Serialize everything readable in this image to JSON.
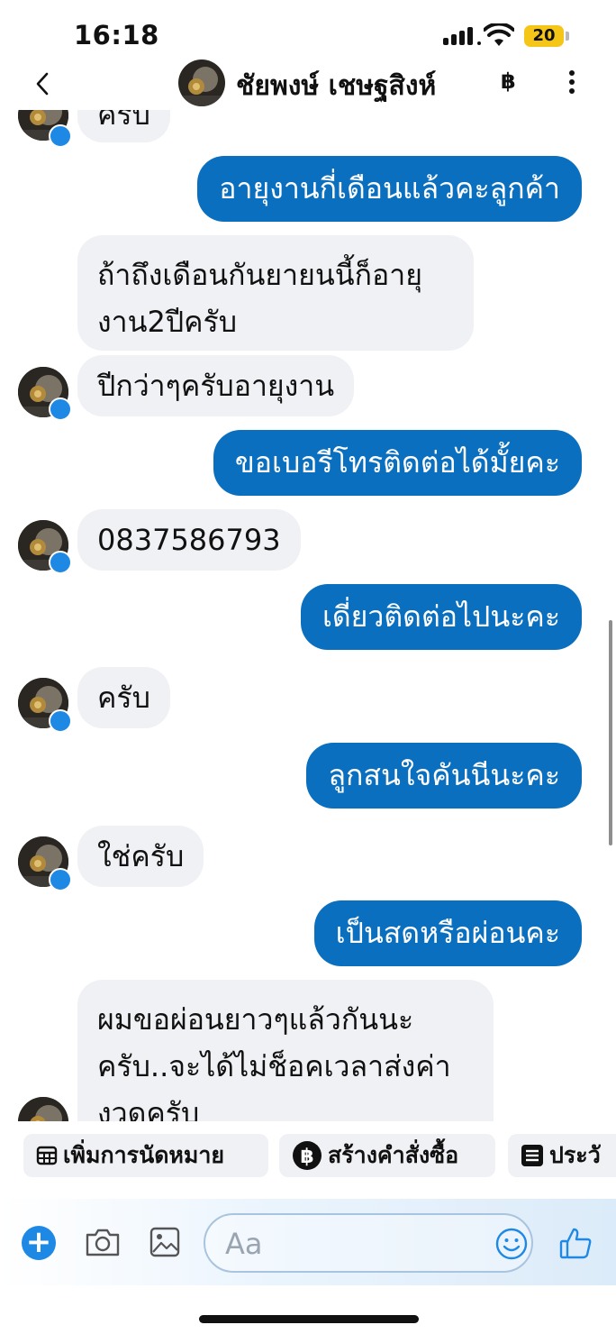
{
  "status_bar": {
    "time": "16:18",
    "battery": "20"
  },
  "header": {
    "contact_name": "ชัยพงษ์ เชษฐสิงห์",
    "baht_icon": "฿"
  },
  "messages": [
    {
      "side": "in",
      "text": "ครับ"
    },
    {
      "side": "out",
      "text": "อายุงานกี่เดือนแล้วคะลูกค้า"
    },
    {
      "side": "in",
      "text": "ถ้าถึงเดือนกันยายนนี้ก็อายุงาน2ปีครับ"
    },
    {
      "side": "in",
      "text": "ปีกว่าๆครับอายุงาน"
    },
    {
      "side": "out",
      "text": "ขอเบอรีโทรติดต่อได้มั้ยคะ"
    },
    {
      "side": "in",
      "text": "0837586793"
    },
    {
      "side": "out",
      "text": "เดี่ยวติดต่อไปนะคะ"
    },
    {
      "side": "in",
      "text": "ครับ"
    },
    {
      "side": "out",
      "text": "ลูกสนใจคันนีนะคะ"
    },
    {
      "side": "in",
      "text": "ใช่ครับ"
    },
    {
      "side": "out",
      "text": "เป็นสดหรือผ่อนคะ"
    },
    {
      "side": "in",
      "text": "ผมขอผ่อนยาวๆแล้วกันนะครับ..จะได้ไม่ช็อคเวลาส่งค่างวดครับ"
    }
  ],
  "quick_actions": [
    {
      "label": "เพิ่มการนัดหมาย",
      "icon": "calendar-icon"
    },
    {
      "label": "สร้างคำสั่งซื้อ",
      "icon": "baht-coin-icon"
    },
    {
      "label": "ประวั",
      "icon": "list-icon"
    }
  ],
  "composer": {
    "placeholder": "Aa"
  },
  "colors": {
    "outgoing_bubble": "#0a6fbf",
    "incoming_bubble": "#f0f1f4",
    "accent": "#1e88e5"
  }
}
